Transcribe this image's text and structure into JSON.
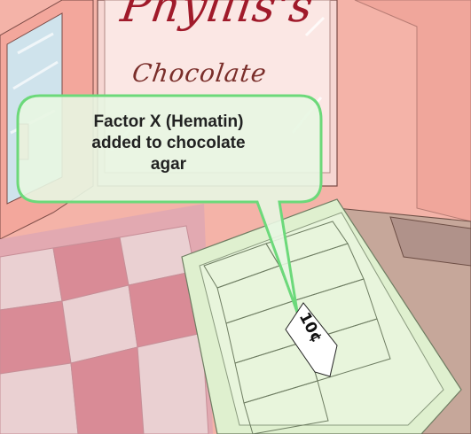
{
  "shop_sign": {
    "name": "Phyllis's",
    "subtitle": "Chocolate"
  },
  "speech_bubble": {
    "lines": [
      "Factor X (Hematin)",
      "added to chocolate",
      "agar"
    ]
  },
  "price_tag": {
    "label": "10¢"
  },
  "colors": {
    "wall": "#f4b3a8",
    "floor_tile_light": "#ead0d2",
    "floor_tile_dark": "#d98b96",
    "bubble_border": "#6cd97a",
    "bubble_fill": "#e8f6e2",
    "tray_fill": "#dff0cf",
    "sign_text": "#a01a2a"
  }
}
